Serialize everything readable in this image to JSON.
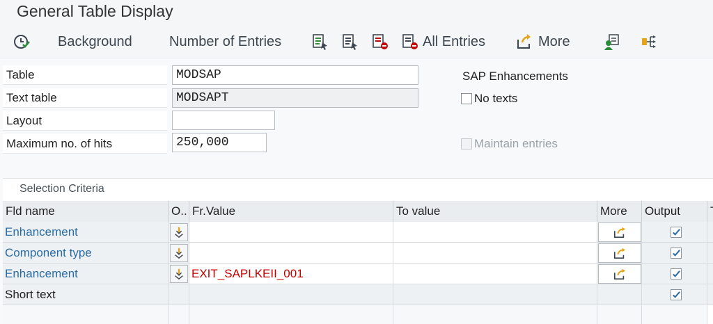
{
  "window": {
    "title": "General Table Display"
  },
  "toolbar": {
    "execute_icon": "execute-clock-icon",
    "background": "Background",
    "number_of_entries": "Number of Entries",
    "all_entries": "All Entries",
    "more": "More"
  },
  "header": {
    "table_label": "Table",
    "table_value": "MODSAP",
    "text_table_label": "Text table",
    "text_table_value": "MODSAPT",
    "layout_label": "Layout",
    "layout_value": "",
    "max_hits_label": "Maximum no. of hits",
    "max_hits_value": "250,000",
    "sap_enhancements": "SAP Enhancements",
    "no_texts_label": "No texts",
    "no_texts_checked": false,
    "maintain_entries_label": "Maintain entries",
    "maintain_entries_enabled": false
  },
  "selection": {
    "title": "Selection Criteria",
    "columns": [
      "Fld name",
      "O..",
      "Fr.Value",
      "To value",
      "More",
      "Output",
      "T"
    ],
    "rows": [
      {
        "name": "Enhancement",
        "from": "",
        "to": "",
        "output": true,
        "link": true,
        "editable": true
      },
      {
        "name": "Component type",
        "from": "",
        "to": "",
        "output": true,
        "link": true,
        "editable": true
      },
      {
        "name": "Enhancement",
        "from": "EXIT_SAPLKEII_001",
        "to": "",
        "output": true,
        "link": true,
        "editable": true
      },
      {
        "name": "Short text",
        "from": "",
        "to": "",
        "output": true,
        "link": false,
        "editable": false
      }
    ]
  },
  "colors": {
    "link": "#2a6ca4",
    "error_text": "#c00000",
    "accent_green": "#2e8b3c",
    "accent_orange": "#e8a317"
  }
}
